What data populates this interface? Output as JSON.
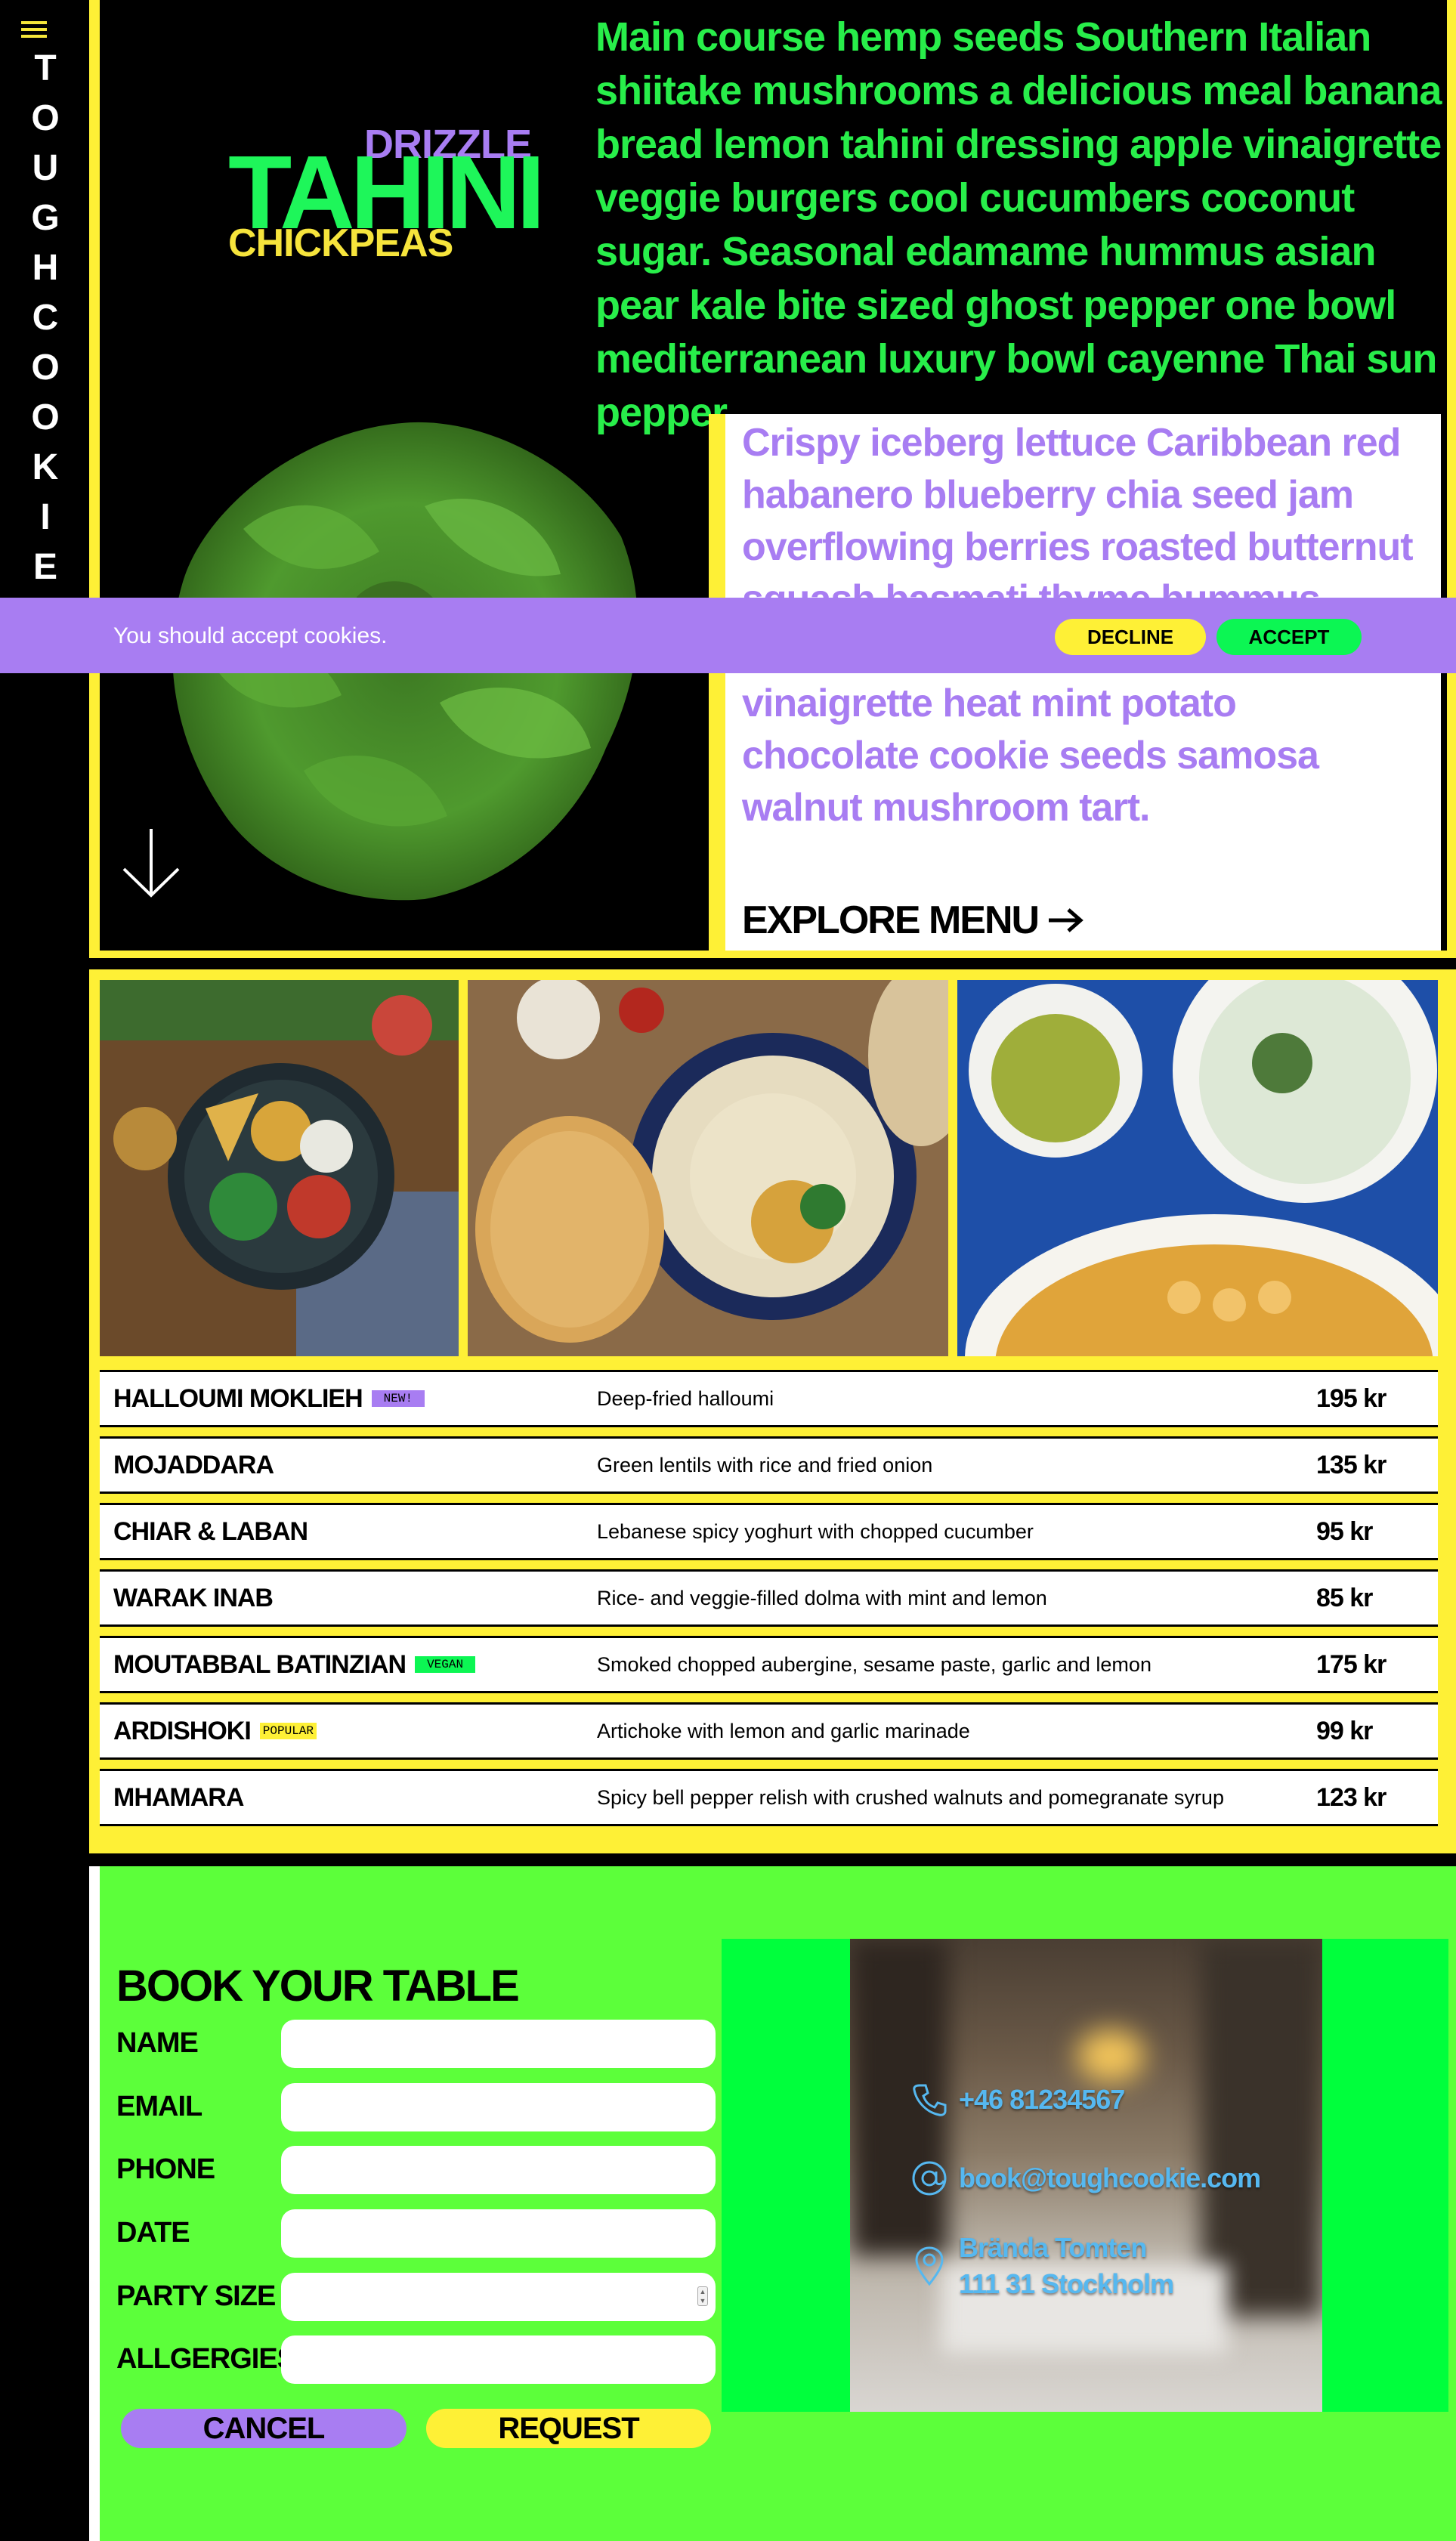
{
  "brand": {
    "vertical_title": "TOUGH COOKIE",
    "logo_drizzle": "DRIZZLE",
    "logo_tahini": "TAHINI",
    "logo_chickpeas": "CHICKPEAS"
  },
  "hero": {
    "text": "Main course hemp seeds Southern Italian shiitake mushrooms a delicious meal banana bread lemon tahini dressing apple vinaigrette veggie burgers cool cucumbers coconut sugar. Seasonal edamame hummus asian pear kale bite sized ghost pepper one bowl mediterranean luxury bowl cayenne Thai sun pepper.",
    "panel_text": "Crispy iceberg lettuce Caribbean red habanero blueberry chia seed jam overflowing berries roasted butternut squash basmati thyme hummus falafel bowl tahini drizzle cilantro lime vinaigrette heat mint potato chocolate cookie seeds samosa walnut mushroom tart.",
    "explore_label": "EXPLORE MENU"
  },
  "cookie": {
    "message": "You should accept cookies.",
    "decline": "DECLINE",
    "accept": "ACCEPT"
  },
  "menu": {
    "items": [
      {
        "name": "HALLOUMI MOKLIEH",
        "badge": "NEW!",
        "desc": "Deep-fried halloumi",
        "price": "195 kr"
      },
      {
        "name": "MOJADDARA",
        "badge": "",
        "desc": "Green lentils with rice and fried onion",
        "price": "135 kr"
      },
      {
        "name": "CHIAR & LABAN",
        "badge": "",
        "desc": "Lebanese spicy yoghurt with chopped cucumber",
        "price": "95 kr"
      },
      {
        "name": "WARAK INAB",
        "badge": "",
        "desc": "Rice- and veggie-filled dolma with mint and lemon",
        "price": "85 kr"
      },
      {
        "name": "MOUTABBAL BATINZIAN",
        "badge": "VEGAN",
        "desc": "Smoked chopped aubergine, sesame paste, garlic and lemon",
        "price": "175 kr"
      },
      {
        "name": "ARDISHOKI",
        "badge": "POPULAR",
        "desc": "Artichoke with lemon and garlic marinade",
        "price": "99 kr"
      },
      {
        "name": "MHAMARA",
        "badge": "",
        "desc": "Spicy bell pepper relish with crushed walnuts and pomegranate syrup",
        "price": "123 kr"
      }
    ]
  },
  "booking": {
    "title": "BOOK YOUR TABLE",
    "fields": [
      "NAME",
      "EMAIL",
      "PHONE",
      "DATE",
      "PARTY SIZE",
      "ALLGERGIES"
    ],
    "cancel": "CANCEL",
    "request": "REQUEST"
  },
  "contact": {
    "phone": "+46 81234567",
    "email": "book@toughcookie.com",
    "address_line1": "Brända Tomten",
    "address_line2": "111 31 Stockholm"
  },
  "colors": {
    "yellow": "#fef036",
    "green": "#28ee4a",
    "purple": "#a87df2",
    "lime": "#5cff3a",
    "neon_green": "#0cf653"
  }
}
